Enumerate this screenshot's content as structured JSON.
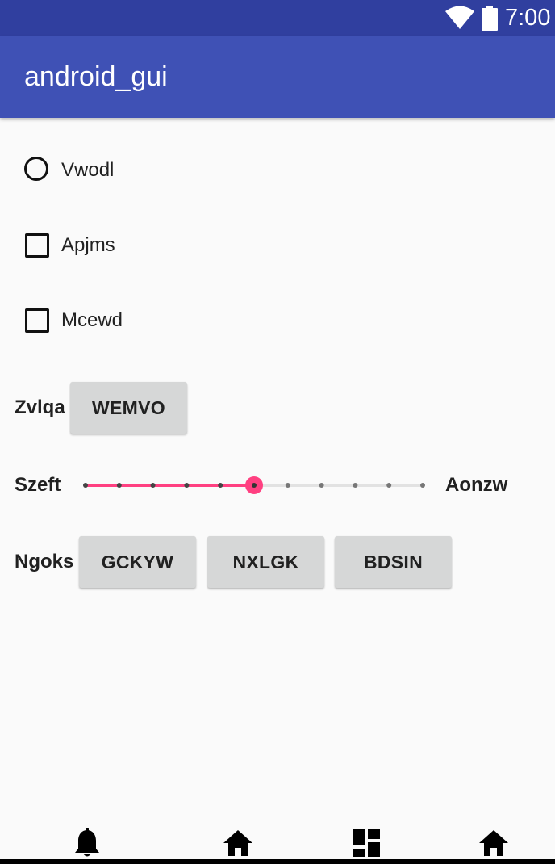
{
  "status_bar": {
    "time": "7:00",
    "icons": [
      "wifi-icon",
      "battery-icon"
    ]
  },
  "app_bar": {
    "title": "android_gui"
  },
  "radio": {
    "label": "Vwodl",
    "checked": false
  },
  "checkboxes": [
    {
      "label": "Apjms",
      "checked": false
    },
    {
      "label": "Mcewd",
      "checked": false
    }
  ],
  "button_row": {
    "label": "Zvlqa",
    "button": "WEMVO"
  },
  "slider": {
    "start_label": "Szeft",
    "end_label": "Aonzw",
    "value": 5,
    "max": 10,
    "accent": "#ff4081"
  },
  "button_group": {
    "label": "Ngoks",
    "buttons": [
      "GCKYW",
      "NXLGK",
      "BDSIN"
    ]
  },
  "bottom_nav": {
    "icons": [
      "bell-icon",
      "home-icon",
      "dashboard-icon",
      "home-icon"
    ]
  },
  "colors": {
    "primary": "#3f51b5",
    "primary_dark": "#303f9f",
    "accent": "#ff4081"
  }
}
